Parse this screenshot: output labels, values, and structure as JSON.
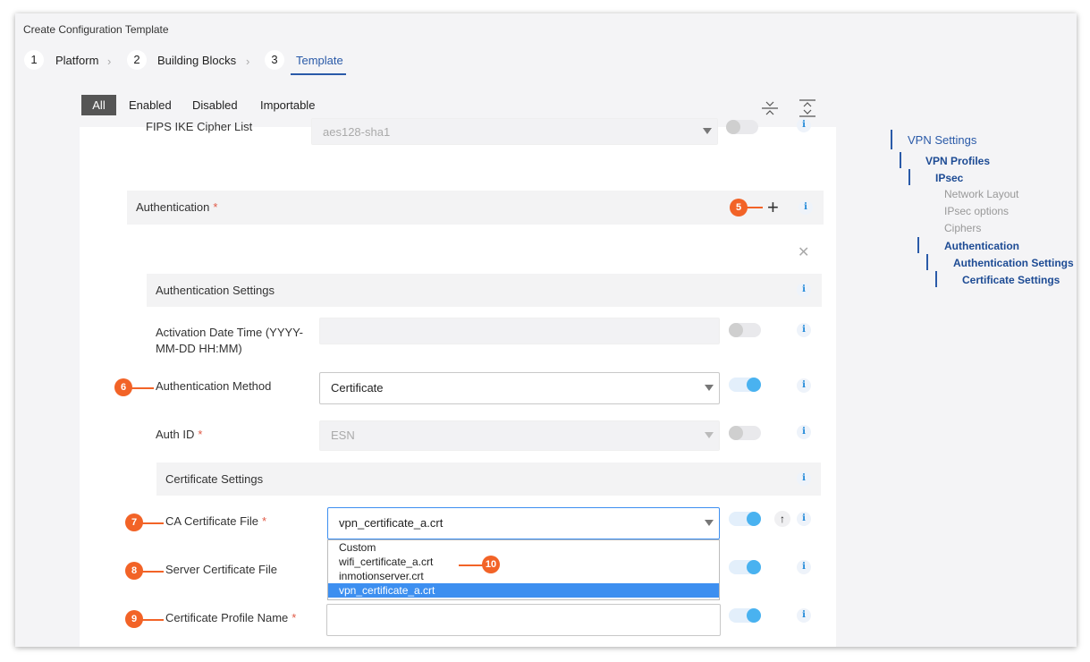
{
  "window": {
    "title": "Create Configuration Template"
  },
  "steps": [
    {
      "num": "1",
      "label": "Platform"
    },
    {
      "num": "2",
      "label": "Building Blocks"
    },
    {
      "num": "3",
      "label": "Template"
    }
  ],
  "filters": [
    "All",
    "Enabled",
    "Disabled",
    "Importable"
  ],
  "form": {
    "partial_row": {
      "label": "FIPS IKE Cipher List",
      "value": "aes128-sha1"
    },
    "authentication": {
      "label": "Authentication",
      "required": "*"
    },
    "auth_settings_header": "Authentication Settings",
    "activation": {
      "label_line1": "Activation Date Time (YYYY-",
      "label_line2": "MM-DD HH:MM)",
      "value": ""
    },
    "auth_method": {
      "label": "Authentication Method",
      "value": "Certificate"
    },
    "auth_id": {
      "label": "Auth ID",
      "required": "*",
      "value": "ESN"
    },
    "cert_settings_header": "Certificate Settings",
    "ca_cert": {
      "label": "CA Certificate File",
      "required": "*",
      "value": "vpn_certificate_a.crt"
    },
    "server_cert": {
      "label": "Server Certificate File"
    },
    "cert_profile": {
      "label": "Certificate Profile Name",
      "required": "*",
      "value": ""
    },
    "dropdown_options": [
      "Custom",
      "wifi_certificate_a.crt",
      "inmotionserver.crt",
      "vpn_certificate_a.crt"
    ],
    "dropdown_selected": "vpn_certificate_a.crt"
  },
  "callouts": [
    "5",
    "6",
    "7",
    "8",
    "9",
    "10"
  ],
  "tree": {
    "items": [
      "VPN Settings",
      "VPN Profiles",
      "IPsec",
      "Network Layout",
      "IPsec options",
      "Ciphers",
      "Authentication",
      "Authentication Settings",
      "Certificate Settings"
    ]
  },
  "icons": {
    "info": "i",
    "plus": "+",
    "close": "✕",
    "upload": "↑",
    "chevron": "›"
  },
  "colors": {
    "accent": "#2a5aa8",
    "callout": "#f26327",
    "toggle_on": "#49b2f0",
    "selection": "#3d8ff0"
  }
}
